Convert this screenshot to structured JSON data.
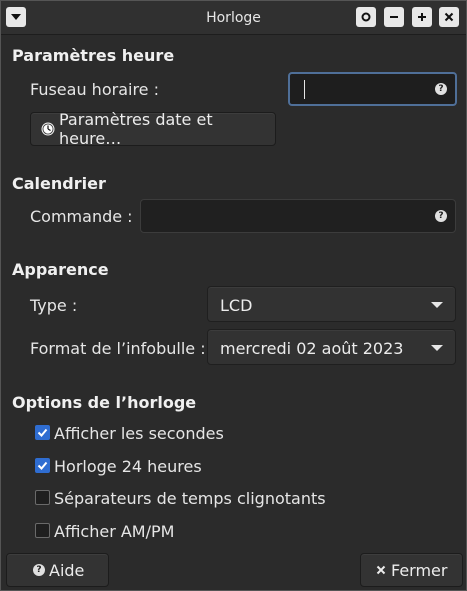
{
  "window": {
    "title": "Horloge",
    "controls": [
      "menu-icon",
      "shade-icon",
      "minimize-icon",
      "maximize-icon",
      "close-icon"
    ]
  },
  "time_section": {
    "heading": "Paramètres heure",
    "timezone_label": "Fuseau horaire :",
    "timezone_value": "",
    "datetime_button_label": "Paramètres date et heure…"
  },
  "calendar_section": {
    "heading": "Calendrier",
    "command_label": "Commande :",
    "command_value": ""
  },
  "appearance_section": {
    "heading": "Apparence",
    "type_label": "Type :",
    "type_value": "LCD",
    "tooltip_format_label": "Format de l’infobulle :",
    "tooltip_format_value": "mercredi 02 août 2023"
  },
  "options_section": {
    "heading": "Options de l’horloge",
    "options": [
      {
        "label": "Afficher les secondes",
        "checked": true
      },
      {
        "label": "Horloge 24 heures",
        "checked": true
      },
      {
        "label": "Séparateurs de temps clignotants",
        "checked": false
      },
      {
        "label": "Afficher AM/PM",
        "checked": false
      }
    ]
  },
  "footer": {
    "help_label": "Aide",
    "close_label": "Fermer"
  },
  "colors": {
    "accent": "#2f6dd1",
    "focus_border": "#4f6f98"
  }
}
